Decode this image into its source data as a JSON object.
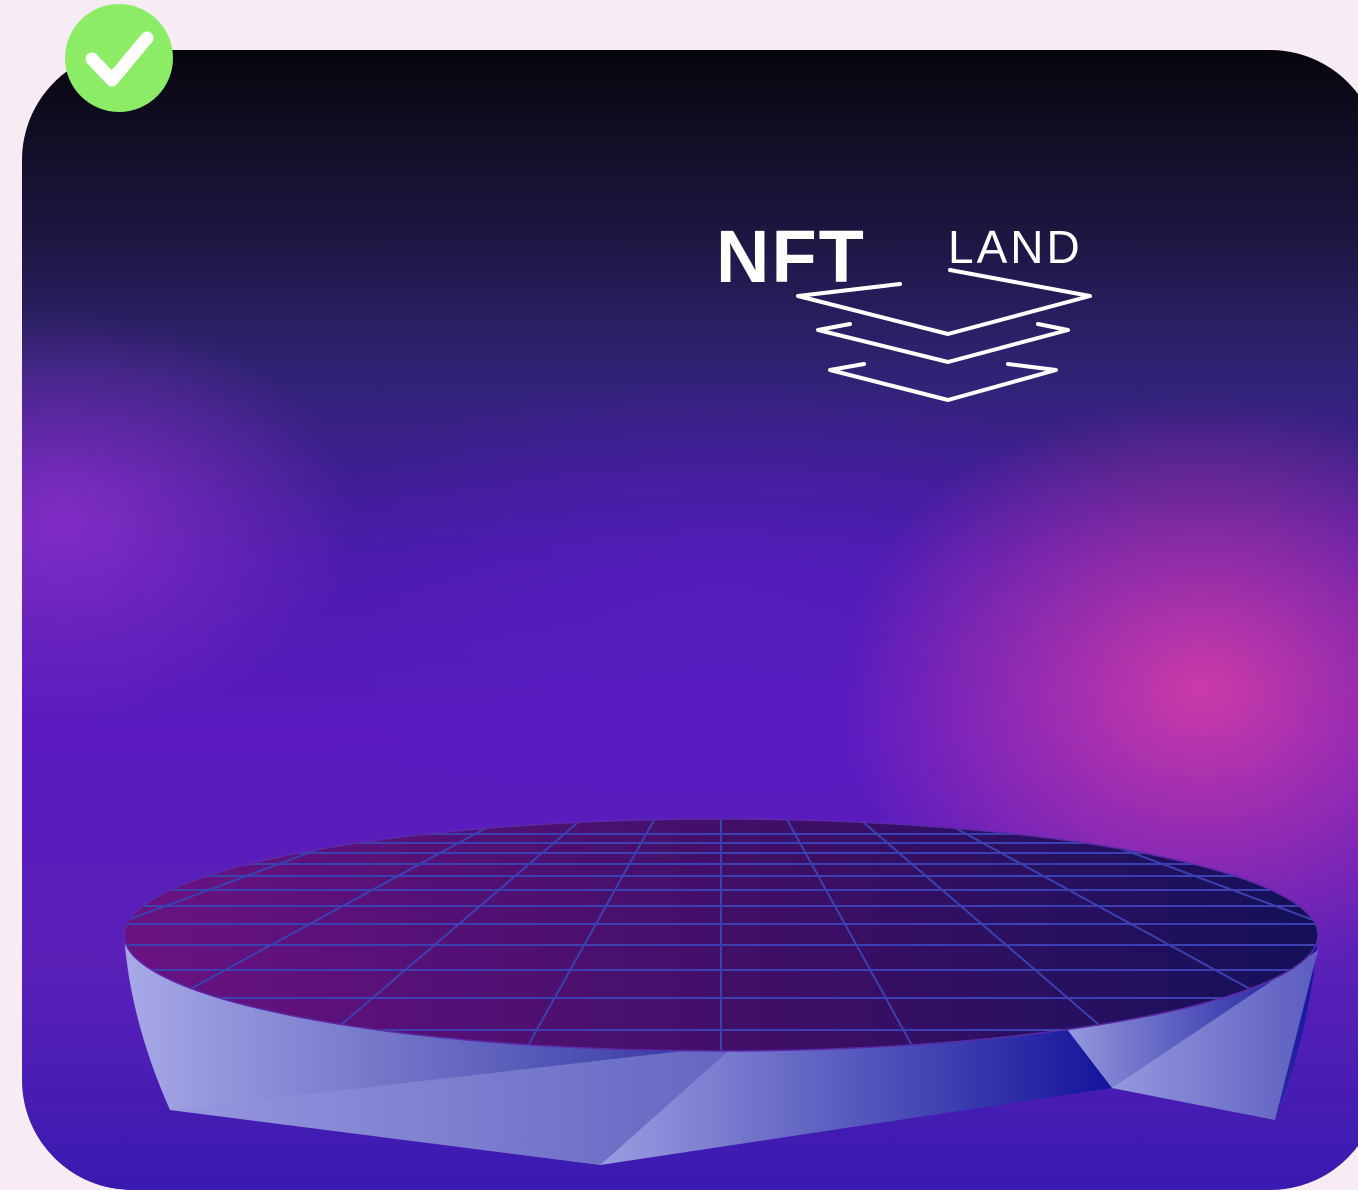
{
  "logo": {
    "text_bold": "NFT",
    "text_light": "LAND",
    "icon": "stacked-layers-icon",
    "color": "#ffffff"
  },
  "badge": {
    "icon": "check-icon",
    "color": "#8cec66"
  },
  "colors": {
    "page_background": "#f7ebf4",
    "card_top": "#07060c",
    "card_mid": "#5a1ac0",
    "accent_pink": "#e040a4",
    "grid_line": "#3a3aa6",
    "platform_side": "#6a70d0"
  }
}
